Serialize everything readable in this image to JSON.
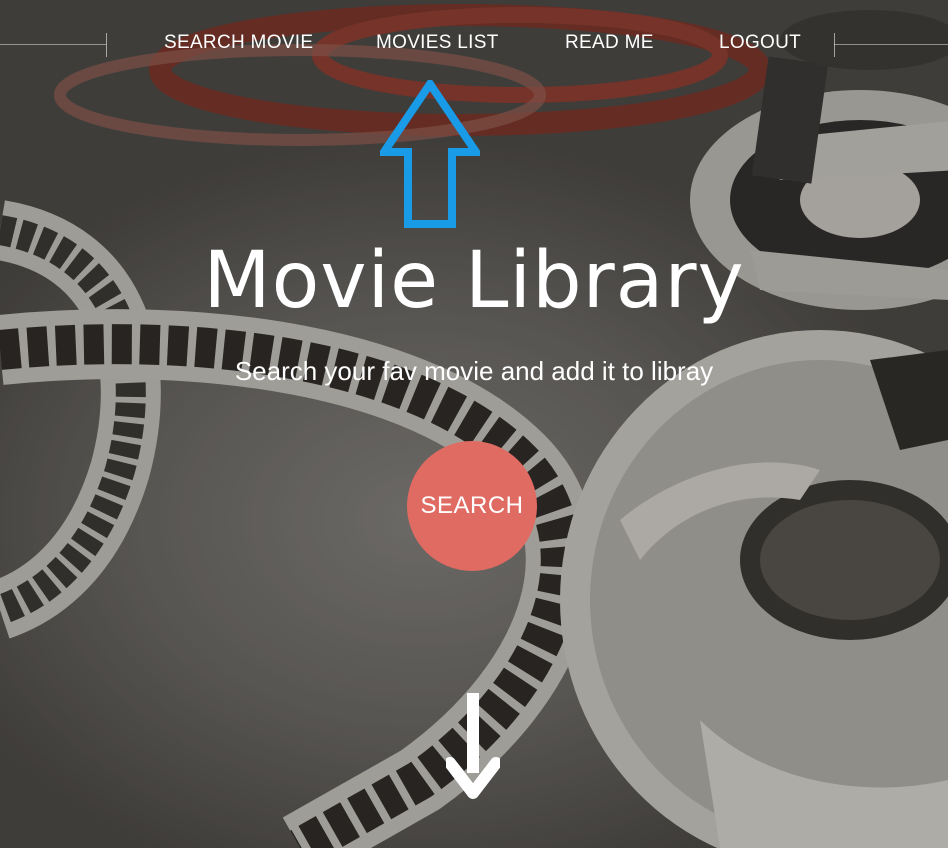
{
  "nav": {
    "items": [
      {
        "label": "SEARCH MOVIE"
      },
      {
        "label": "MOVIES LIST"
      },
      {
        "label": "READ ME"
      },
      {
        "label": "LOGOUT"
      }
    ]
  },
  "hero": {
    "title": "Movie Library",
    "subtitle": "Search your fav movie and add it to libray",
    "search_label": "SEARCH"
  },
  "icons": {
    "annotation": "up-arrow-icon",
    "scroll": "down-arrow-icon"
  },
  "colors": {
    "accent": "#e06b62",
    "annotation": "#1a9be8",
    "text": "#ffffff"
  }
}
